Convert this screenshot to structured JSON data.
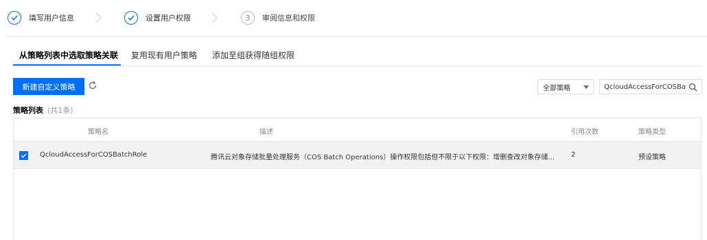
{
  "steps": [
    {
      "label": "填写用户信息",
      "status": "done"
    },
    {
      "label": "设置用户权限",
      "status": "done"
    },
    {
      "label": "审阅信息和权限",
      "status": "pending",
      "number": "3"
    }
  ],
  "tabs": [
    {
      "label": "从策略列表中选取策略关联",
      "active": true
    },
    {
      "label": "复用现有用户策略",
      "active": false
    },
    {
      "label": "添加至组获得随组权限",
      "active": false
    }
  ],
  "toolbar": {
    "new_policy_label": "新建自定义策略",
    "filter_selected": "全部策略",
    "search_value": "QcloudAccessForCOSBatchRole"
  },
  "list": {
    "title": "策略列表",
    "count": "(共1条)"
  },
  "table": {
    "columns": [
      "策略名",
      "描述",
      "引用次数",
      "策略类型"
    ],
    "rows": [
      {
        "checked": true,
        "name": "QcloudAccessForCOSBatchRole",
        "description": "腾讯云对象存储批量处理服务（COS Batch Operations）操作权限包括但不限于以下权限：增删查改对象存储(C...",
        "references": "2",
        "type": "预设策略"
      }
    ]
  },
  "colors": {
    "accent": "#006eff",
    "row_selected_bg": "#f2f2f2"
  }
}
